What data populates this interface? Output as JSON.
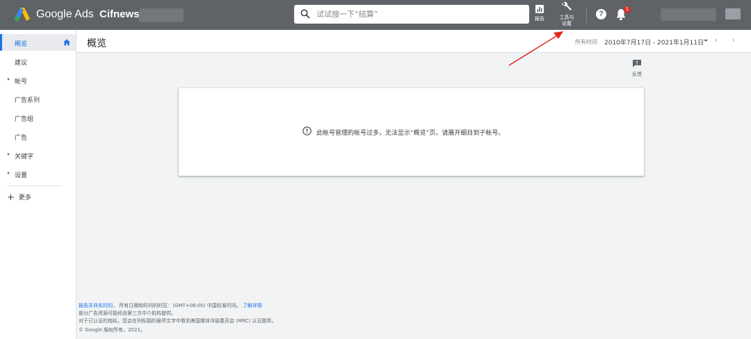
{
  "colors": {
    "topbar": "#5f6368",
    "accent": "#1a73e8",
    "badge": "#d93025",
    "annotation": "#e0251b"
  },
  "header": {
    "brand": "Google Ads",
    "account_name": "Cifnews",
    "search_placeholder": "试试搜一下“结算”",
    "reports_label": "报告",
    "tools_label_line1": "工具与",
    "tools_label_line2": "设置",
    "help_glyph": "?",
    "notification_count": "1",
    "icons": [
      "google-ads-logo",
      "search-icon",
      "reports-icon",
      "wrench-icon",
      "help-icon",
      "bell-icon"
    ]
  },
  "sidebar": {
    "items": [
      {
        "label": "概览",
        "active": true
      },
      {
        "label": "建议"
      },
      {
        "label": "帐号",
        "expandable": true
      },
      {
        "label": "广告系列"
      },
      {
        "label": "广告组"
      },
      {
        "label": "广告"
      },
      {
        "label": "关键字",
        "expandable": true
      },
      {
        "label": "设置",
        "expandable": true
      }
    ],
    "more_label": "更多"
  },
  "page": {
    "title": "概览",
    "date_range_label": "所有时间",
    "date_range_value": "2010年7月17日 - 2021年1月11日",
    "feedback_label": "反馈"
  },
  "notice": {
    "text": "此帐号管理的帐号过多，无法显示“概览”页。请展开细目到子帐号。"
  },
  "footer": {
    "line1_link": "报告并非实时的。",
    "line1_text": "所有日期和时间的时区：(GMT+08:00) 中国标准时间。",
    "line1_more": "了解详情",
    "line2": "部分广告资源可能经由第三方中介机构提供。",
    "line3": "对于已认证的指标，您会在列标题的悬停文字中看到美国媒体评级委员会 (MRC) 认证徽章。",
    "copyright": "© Google 版权所有，2021。"
  }
}
